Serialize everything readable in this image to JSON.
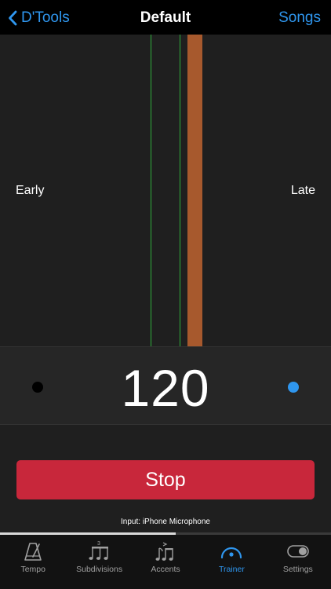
{
  "nav": {
    "back_label": "D'Tools",
    "title": "Default",
    "right_label": "Songs"
  },
  "timing": {
    "early_label": "Early",
    "late_label": "Late"
  },
  "tempo": {
    "value": "120"
  },
  "controls": {
    "stop_label": "Stop",
    "input_label": "Input: iPhone Microphone",
    "progress_fraction": 0.53
  },
  "tabs": [
    {
      "label": "Tempo",
      "icon": "metronome-icon",
      "active": false
    },
    {
      "label": "Subdivisions",
      "icon": "triplet-notes-icon",
      "active": false
    },
    {
      "label": "Accents",
      "icon": "accent-notes-icon",
      "active": false
    },
    {
      "label": "Trainer",
      "icon": "gauge-icon",
      "active": true
    },
    {
      "label": "Settings",
      "icon": "toggle-icon",
      "active": false
    }
  ],
  "colors": {
    "accent": "#2f96ee",
    "stop": "#c8273b",
    "hit_bar": "#a7592d",
    "window_line": "#2fae3c"
  }
}
